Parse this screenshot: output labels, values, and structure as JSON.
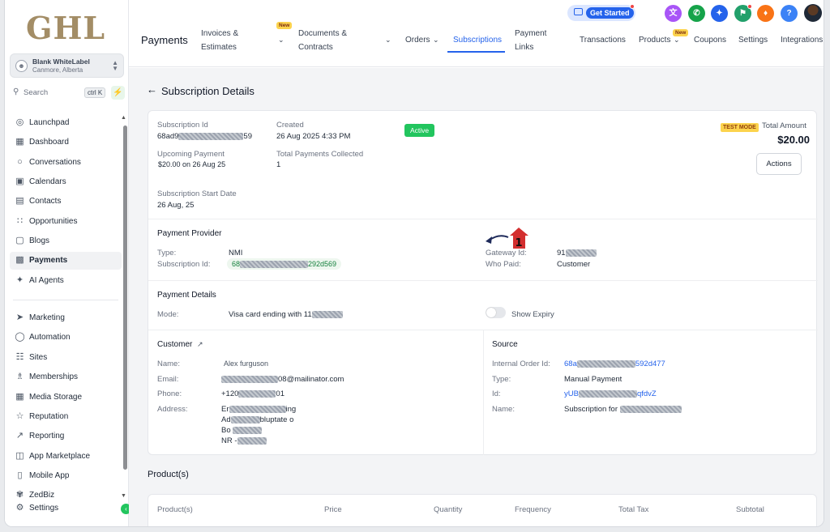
{
  "sidebar": {
    "logo": "GHL",
    "account": {
      "name": "Blank WhiteLabel",
      "location": "Canmore, Alberta"
    },
    "search": {
      "label": "Search",
      "shortcut": "ctrl K"
    },
    "items": [
      {
        "label": "Launchpad",
        "icon": "rocket-icon"
      },
      {
        "label": "Dashboard",
        "icon": "grid-icon"
      },
      {
        "label": "Conversations",
        "icon": "chat-icon"
      },
      {
        "label": "Calendars",
        "icon": "calendar-icon"
      },
      {
        "label": "Contacts",
        "icon": "contacts-icon"
      },
      {
        "label": "Opportunities",
        "icon": "opportunities-icon"
      },
      {
        "label": "Blogs",
        "icon": "blogs-icon"
      },
      {
        "label": "Payments",
        "icon": "payments-icon"
      },
      {
        "label": "AI Agents",
        "icon": "sparkle-icon"
      },
      {
        "label": "Marketing",
        "icon": "send-icon"
      },
      {
        "label": "Automation",
        "icon": "automation-icon"
      },
      {
        "label": "Sites",
        "icon": "sites-icon"
      },
      {
        "label": "Memberships",
        "icon": "memberships-icon"
      },
      {
        "label": "Media Storage",
        "icon": "image-icon"
      },
      {
        "label": "Reputation",
        "icon": "star-icon"
      },
      {
        "label": "Reporting",
        "icon": "chart-icon"
      },
      {
        "label": "App Marketplace",
        "icon": "marketplace-icon"
      },
      {
        "label": "Mobile App",
        "icon": "mobile-icon"
      },
      {
        "label": "ZedBiz",
        "icon": "zedbiz-icon"
      },
      {
        "label": "Settings",
        "icon": "gear-icon"
      }
    ]
  },
  "topbar": {
    "get_started": "Get Started",
    "module": "Payments",
    "tabs": {
      "invoices_1": "Invoices &",
      "invoices_2": "Estimates",
      "documents_1": "Documents &",
      "documents_2": "Contracts",
      "orders": "Orders",
      "subscriptions": "Subscriptions",
      "payment_links_1": "Payment",
      "payment_links_2": "Links",
      "transactions": "Transactions",
      "products": "Products",
      "coupons": "Coupons",
      "settings": "Settings",
      "integrations": "Integrations"
    },
    "new_badge": "New"
  },
  "page": {
    "title": "Subscription Details",
    "subscription": {
      "id_label": "Subscription Id",
      "id_prefix": "68ad9",
      "id_suffix": "59",
      "created_label": "Created",
      "created_value": "26 Aug 2025 4:33 PM",
      "status": "Active",
      "test_mode": "TEST MODE",
      "total_label": "Total Amount",
      "total_value": "$20.00",
      "actions": "Actions",
      "upcoming_label": "Upcoming Payment",
      "upcoming_value": "$20.00  on 26 Aug 25",
      "collected_label": "Total Payments Collected",
      "collected_value": "1",
      "start_label": "Subscription Start Date",
      "start_value": "26 Aug, 25",
      "annotation_number": "1"
    },
    "provider": {
      "title": "Payment Provider",
      "type_label": "Type:",
      "type_value": "NMI",
      "sub_id_label": "Subscription Id:",
      "sub_id_prefix": "68",
      "sub_id_suffix": "292d569",
      "gateway_label": "Gateway Id:",
      "gateway_prefix": "91",
      "who_paid_label": "Who Paid:",
      "who_paid_value": "Customer"
    },
    "payment_details": {
      "title": "Payment Details",
      "mode_label": "Mode:",
      "mode_value": "Visa card ending with 11",
      "show_expiry": "Show Expiry"
    },
    "customer": {
      "title": "Customer",
      "name_label": "Name:",
      "name_value": "Alex furguson",
      "email_label": "Email:",
      "email_suffix": "08@mailinator.com",
      "phone_label": "Phone:",
      "phone_prefix": "+120",
      "phone_suffix": "01",
      "address_label": "Address:",
      "addr1_prefix": "Er",
      "addr1_suffix": "ing",
      "addr2_prefix": "Ad",
      "addr2_suffix": "bluptate o",
      "addr3_prefix": "Bo",
      "addr4_prefix": "NR -"
    },
    "source": {
      "title": "Source",
      "order_label": "Internal Order Id:",
      "order_prefix": "68a",
      "order_suffix": "592d477",
      "type_label": "Type:",
      "type_value": "Manual Payment",
      "id_label": "Id:",
      "id_prefix": "yUB",
      "id_suffix": "qfdvZ",
      "name_label": "Name:",
      "name_value": "Subscription for"
    },
    "products": {
      "title": "Product(s)",
      "columns": [
        "Product(s)",
        "Price",
        "Quantity",
        "Frequency",
        "Total Tax",
        "Subtotal"
      ]
    }
  },
  "colors": {
    "accent": "#2563eb",
    "active_status": "#22c55e",
    "logo": "#a38d66"
  }
}
